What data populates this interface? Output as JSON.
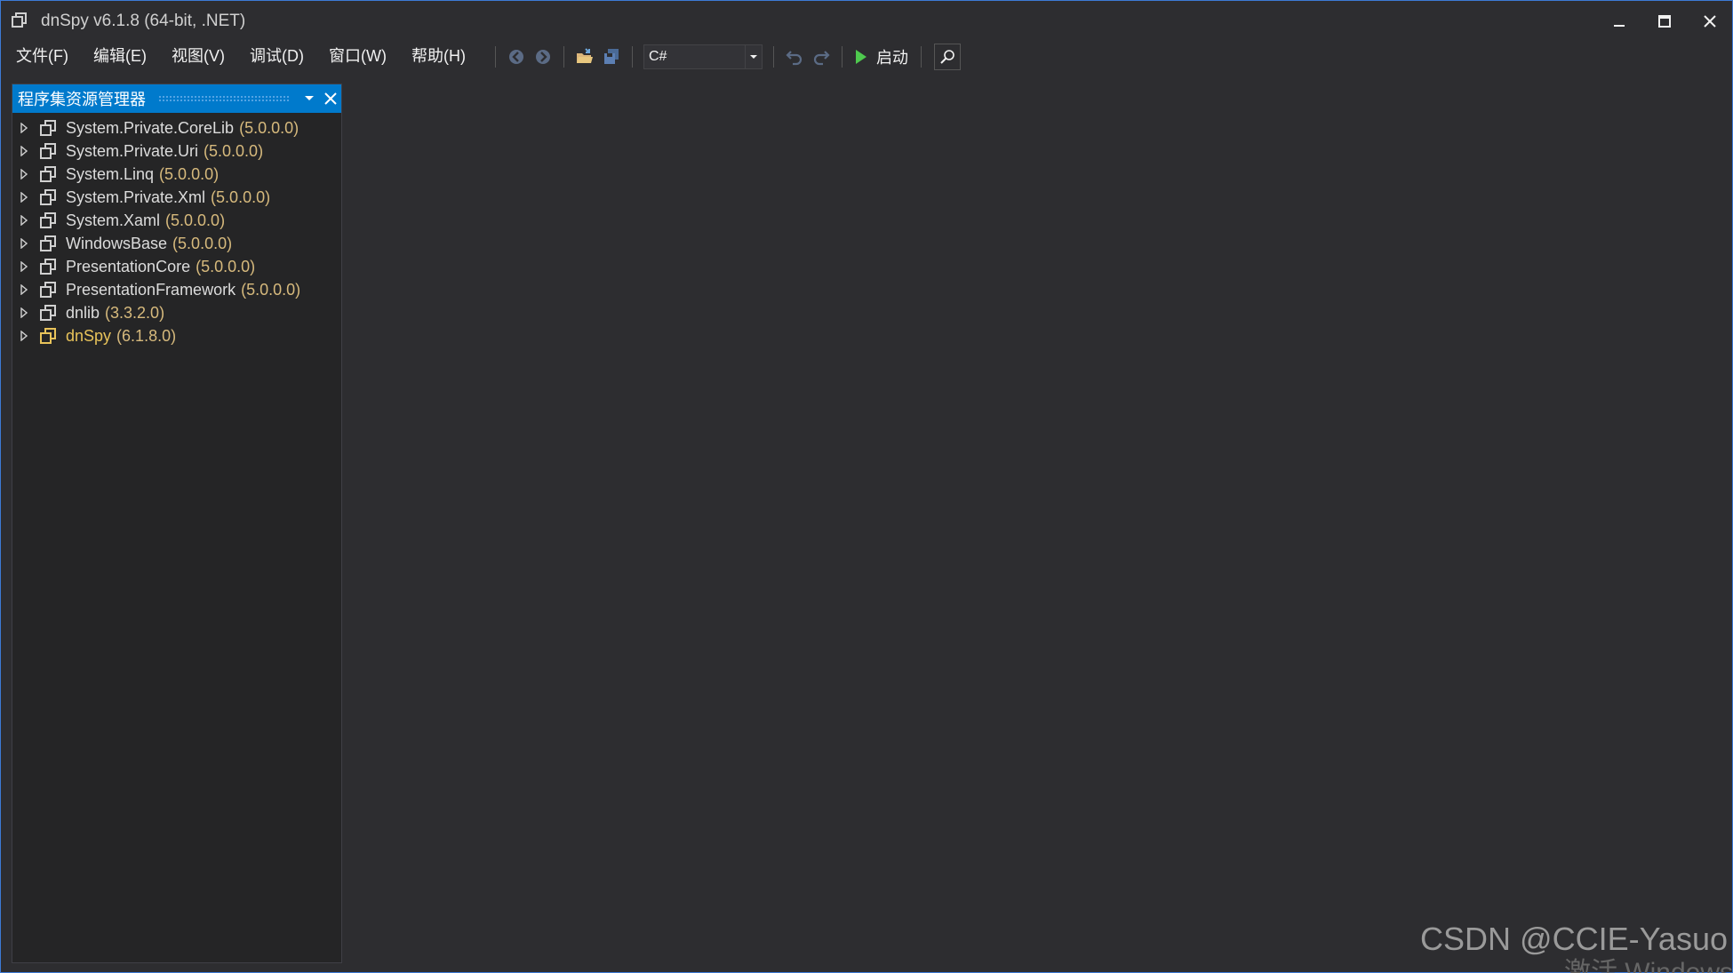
{
  "window": {
    "title": "dnSpy v6.1.8 (64-bit, .NET)"
  },
  "menu": [
    {
      "label": "文件(F)"
    },
    {
      "label": "编辑(E)"
    },
    {
      "label": "视图(V)"
    },
    {
      "label": "调试(D)"
    },
    {
      "label": "窗口(W)"
    },
    {
      "label": "帮助(H)"
    }
  ],
  "toolbar": {
    "language": "C#",
    "start_label": "启动",
    "icons": [
      "back-arrow-icon",
      "forward-arrow-icon",
      "open-folder-icon",
      "save-all-icon",
      "undo-icon",
      "redo-icon",
      "play-icon",
      "search-icon"
    ]
  },
  "panel": {
    "title": "程序集资源管理器",
    "assemblies": [
      {
        "name": "System.Private.CoreLib",
        "version": "(5.0.0.0)"
      },
      {
        "name": "System.Private.Uri",
        "version": "(5.0.0.0)"
      },
      {
        "name": "System.Linq",
        "version": "(5.0.0.0)"
      },
      {
        "name": "System.Private.Xml",
        "version": "(5.0.0.0)"
      },
      {
        "name": "System.Xaml",
        "version": "(5.0.0.0)"
      },
      {
        "name": "WindowsBase",
        "version": "(5.0.0.0)"
      },
      {
        "name": "PresentationCore",
        "version": "(5.0.0.0)"
      },
      {
        "name": "PresentationFramework",
        "version": "(5.0.0.0)"
      },
      {
        "name": "dnlib",
        "version": "(3.3.2.0)"
      },
      {
        "name": "dnSpy",
        "version": "(6.1.8.0)"
      }
    ]
  },
  "watermark": {
    "text": "CSDN @CCIE-Yasuo",
    "partial": "激活 Windows"
  },
  "colors": {
    "accent": "#007acc",
    "background": "#2d2d30",
    "version_text": "#d7ba7d",
    "highlight_name": "#e8c35a"
  }
}
